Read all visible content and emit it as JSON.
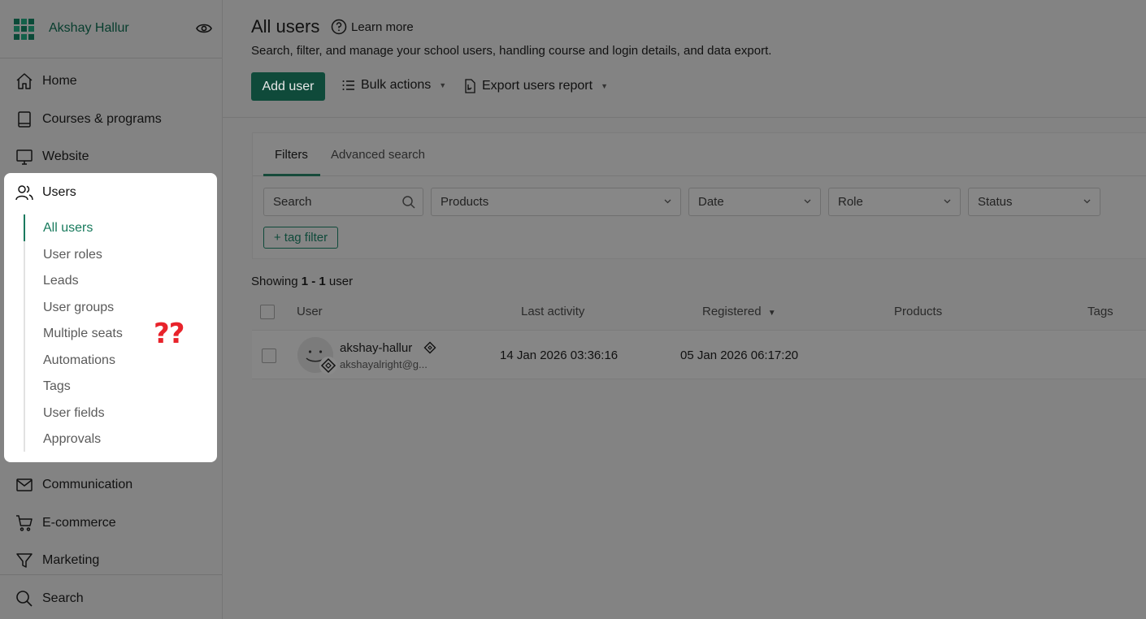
{
  "app": {
    "school_name": "Akshay Hallur"
  },
  "nav": {
    "home": "Home",
    "courses": "Courses & programs",
    "website": "Website",
    "users": "Users",
    "communication": "Communication",
    "ecommerce": "E-commerce",
    "marketing": "Marketing",
    "search": "Search"
  },
  "users_menu": [
    {
      "label": "All users",
      "active": true
    },
    {
      "label": "User roles"
    },
    {
      "label": "Leads"
    },
    {
      "label": "User groups"
    },
    {
      "label": "Multiple seats"
    },
    {
      "label": "Automations"
    },
    {
      "label": "Tags"
    },
    {
      "label": "User fields"
    },
    {
      "label": "Approvals"
    }
  ],
  "annotation": {
    "text": "??",
    "color": "#e8232b"
  },
  "page": {
    "title": "All users",
    "learn_more": "Learn more",
    "description": "Search, filter, and manage your school users, handling course and login details, and data export.",
    "add_user": "Add user",
    "bulk_actions": "Bulk actions",
    "export_report": "Export users report"
  },
  "filters": {
    "tabs": [
      "Filters",
      "Advanced search"
    ],
    "search_placeholder": "Search",
    "products": "Products",
    "date": "Date",
    "role": "Role",
    "status": "Status",
    "tag_filter": "+ tag filter"
  },
  "results": {
    "prefix": "Showing",
    "range": "1 - 1",
    "suffix": "user"
  },
  "table": {
    "headers": {
      "user": "User",
      "last_activity": "Last activity",
      "registered": "Registered",
      "registered_sort": "▼",
      "products": "Products",
      "tags": "Tags"
    },
    "rows": [
      {
        "name": "akshay-hallur",
        "email": "akshayalright@g...",
        "last_activity": "14 Jan 2026 03:36:16",
        "registered": "05 Jan 2026 06:17:20",
        "products": "",
        "tags": ""
      }
    ]
  },
  "colors": {
    "brand": "#0f4a3a",
    "active_link": "#177a5c",
    "overlay": "#838383"
  }
}
